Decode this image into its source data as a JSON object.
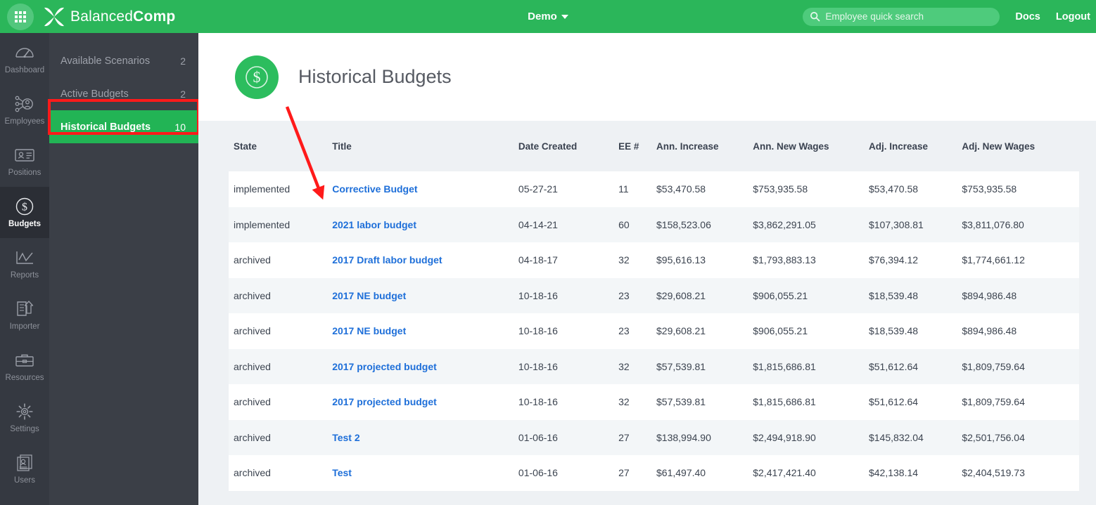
{
  "topbar": {
    "apps_icon": "grid-apps-icon",
    "brand_light": "Balanced",
    "brand_bold": "Comp",
    "org_menu_label": "Demo",
    "search_placeholder": "Employee quick search",
    "search_value": "",
    "docs_label": "Docs",
    "logout_label": "Logout",
    "bg_color": "#2bb65a"
  },
  "rail": {
    "items": [
      {
        "label": "Dashboard",
        "icon": "gauge-icon",
        "active": false
      },
      {
        "label": "Employees",
        "icon": "org-people-icon",
        "active": false
      },
      {
        "label": "Positions",
        "icon": "id-card-icon",
        "active": false
      },
      {
        "label": "Budgets",
        "icon": "dollar-circle-icon",
        "active": true
      },
      {
        "label": "Reports",
        "icon": "line-chart-icon",
        "active": false
      },
      {
        "label": "Importer",
        "icon": "import-document-icon",
        "active": false
      },
      {
        "label": "Resources",
        "icon": "briefcase-icon",
        "active": false
      },
      {
        "label": "Settings",
        "icon": "gear-icon",
        "active": false
      },
      {
        "label": "Users",
        "icon": "user-cards-icon",
        "active": false
      }
    ]
  },
  "subnav": {
    "items": [
      {
        "label": "Available Scenarios",
        "count": "2",
        "active": false
      },
      {
        "label": "Active Budgets",
        "count": "2",
        "active": false
      },
      {
        "label": "Historical Budgets",
        "count": "10",
        "active": true
      }
    ],
    "active_color": "#22b455",
    "annotation_color": "#ff1a1a"
  },
  "page": {
    "badge_icon": "dollar-circle-icon",
    "title": "Historical Budgets"
  },
  "table": {
    "columns": [
      "State",
      "Title",
      "Date Created",
      "EE #",
      "Ann. Increase",
      "Ann. New Wages",
      "Adj. Increase",
      "Adj. New Wages"
    ],
    "rows": [
      {
        "state": "implemented",
        "title": "Corrective Budget",
        "date_created": "05-27-21",
        "ee": "11",
        "ann_increase": "$53,470.58",
        "ann_new_wages": "$753,935.58",
        "adj_increase": "$53,470.58",
        "adj_new_wages": "$753,935.58"
      },
      {
        "state": "implemented",
        "title": "2021 labor budget",
        "date_created": "04-14-21",
        "ee": "60",
        "ann_increase": "$158,523.06",
        "ann_new_wages": "$3,862,291.05",
        "adj_increase": "$107,308.81",
        "adj_new_wages": "$3,811,076.80"
      },
      {
        "state": "archived",
        "title": "2017 Draft labor budget",
        "date_created": "04-18-17",
        "ee": "32",
        "ann_increase": "$95,616.13",
        "ann_new_wages": "$1,793,883.13",
        "adj_increase": "$76,394.12",
        "adj_new_wages": "$1,774,661.12"
      },
      {
        "state": "archived",
        "title": "2017 NE budget",
        "date_created": "10-18-16",
        "ee": "23",
        "ann_increase": "$29,608.21",
        "ann_new_wages": "$906,055.21",
        "adj_increase": "$18,539.48",
        "adj_new_wages": "$894,986.48"
      },
      {
        "state": "archived",
        "title": "2017 NE budget",
        "date_created": "10-18-16",
        "ee": "23",
        "ann_increase": "$29,608.21",
        "ann_new_wages": "$906,055.21",
        "adj_increase": "$18,539.48",
        "adj_new_wages": "$894,986.48"
      },
      {
        "state": "archived",
        "title": "2017 projected budget",
        "date_created": "10-18-16",
        "ee": "32",
        "ann_increase": "$57,539.81",
        "ann_new_wages": "$1,815,686.81",
        "adj_increase": "$51,612.64",
        "adj_new_wages": "$1,809,759.64"
      },
      {
        "state": "archived",
        "title": "2017 projected budget",
        "date_created": "10-18-16",
        "ee": "32",
        "ann_increase": "$57,539.81",
        "ann_new_wages": "$1,815,686.81",
        "adj_increase": "$51,612.64",
        "adj_new_wages": "$1,809,759.64"
      },
      {
        "state": "archived",
        "title": "Test 2",
        "date_created": "01-06-16",
        "ee": "27",
        "ann_increase": "$138,994.90",
        "ann_new_wages": "$2,494,918.90",
        "adj_increase": "$145,832.04",
        "adj_new_wages": "$2,501,756.04"
      },
      {
        "state": "archived",
        "title": "Test",
        "date_created": "01-06-16",
        "ee": "27",
        "ann_increase": "$61,497.40",
        "ann_new_wages": "$2,417,421.40",
        "adj_increase": "$42,138.14",
        "adj_new_wages": "$2,404,519.73"
      }
    ]
  },
  "annotation": {
    "arrow_color": "#ff1a1a",
    "arrow_from": "408,152",
    "arrow_to": "461,285"
  }
}
